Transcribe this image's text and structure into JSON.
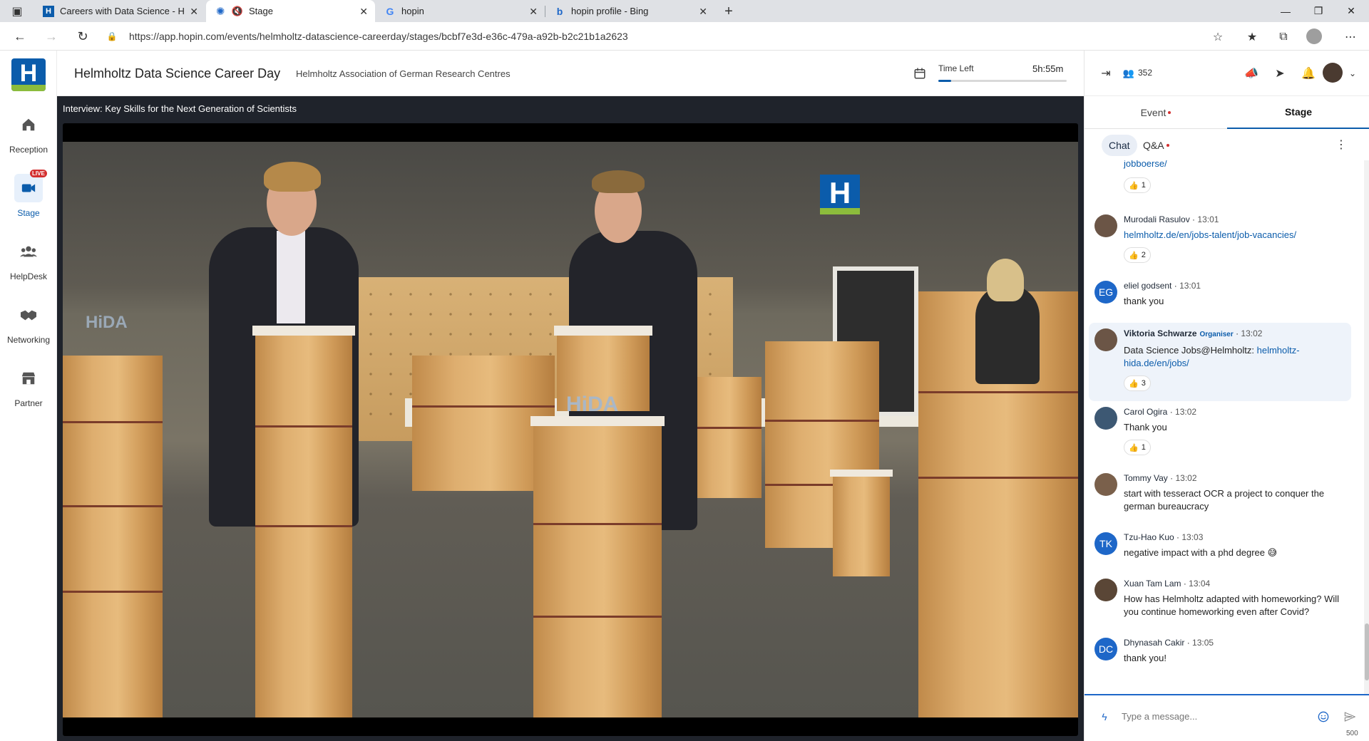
{
  "browser": {
    "tabs": [
      {
        "title": "Careers with Data Science - Helm",
        "favicon": "helmholtz-h-icon"
      },
      {
        "title": "Stage",
        "favicon": "hopin-icon",
        "muted": true
      },
      {
        "title": "hopin",
        "favicon": "google-g-icon"
      },
      {
        "title": "hopin profile - Bing",
        "favicon": "bing-b-icon"
      }
    ],
    "url": "https://app.hopin.com/events/helmholtz-datascience-careerday/stages/bcbf7e3d-e36c-479a-a92b-b2c21b1a2623"
  },
  "nav": {
    "items": [
      {
        "label": "Reception",
        "icon": "home-icon"
      },
      {
        "label": "Stage",
        "icon": "video-camera-icon",
        "badge": "LIVE"
      },
      {
        "label": "HelpDesk",
        "icon": "people-group-icon"
      },
      {
        "label": "Networking",
        "icon": "handshake-icon"
      },
      {
        "label": "Partner",
        "icon": "store-icon"
      }
    ]
  },
  "header": {
    "title": "Helmholtz Data Science Career Day",
    "organizer": "Helmholtz Association of German Research Centres",
    "time_left_label": "Time Left",
    "time_left": "5h:55m",
    "time_progress_percent": 10
  },
  "stage": {
    "session_title": "Interview: Key Skills for the Next Generation of Scientists"
  },
  "sidebar": {
    "attendees": "352",
    "tabs": [
      "Event",
      "Stage"
    ],
    "subtabs": [
      "Chat",
      "Q&A"
    ],
    "messages": [
      {
        "name": "",
        "time": "",
        "text": "",
        "link": "jobboerse/",
        "reactions": "1",
        "avatar": ""
      },
      {
        "name": "Murodali Rasulov",
        "time": "13:01",
        "text": "",
        "link": "helmholtz.de/en/jobs-talent/job-vacancies/",
        "reactions": "2",
        "avatar": "photo"
      },
      {
        "name": "eliel godsent",
        "time": "13:01",
        "text": "thank you",
        "link": "",
        "reactions": "",
        "avatar": "EG"
      },
      {
        "name": "Viktoria Schwarze",
        "time": "13:02",
        "badge": "Organiser",
        "text": "Data Science Jobs@Helmholtz: ",
        "link": "helmholtz-hida.de/en/jobs/",
        "reactions": "3",
        "avatar": "photo"
      },
      {
        "name": "Carol Ogira",
        "time": "13:02",
        "text": "Thank you",
        "link": "",
        "reactions": "1",
        "avatar": "photo"
      },
      {
        "name": "Tommy Vay",
        "time": "13:02",
        "text": "start with tesseract OCR a project to conquer the german bureaucracy",
        "link": "",
        "reactions": "",
        "avatar": "photo"
      },
      {
        "name": "Tzu-Hao Kuo",
        "time": "13:03",
        "text": "negative impact with a phd degree 😅",
        "link": "",
        "reactions": "",
        "avatar": "TK"
      },
      {
        "name": "Xuan Tam Lam",
        "time": "13:04",
        "text": "How has Helmholtz adapted with homeworking? Will you continue homeworking even after Covid?",
        "link": "",
        "reactions": "",
        "avatar": "photo"
      },
      {
        "name": "Dhynasah Cakir",
        "time": "13:05",
        "text": "thank you!",
        "link": "",
        "reactions": "",
        "avatar": "DC"
      }
    ],
    "compose_placeholder": "Type a message...",
    "char_limit": "500"
  },
  "colors": {
    "brand": "#0b5cab",
    "accent_green": "#8cbc3c",
    "live": "#d32f2f"
  }
}
